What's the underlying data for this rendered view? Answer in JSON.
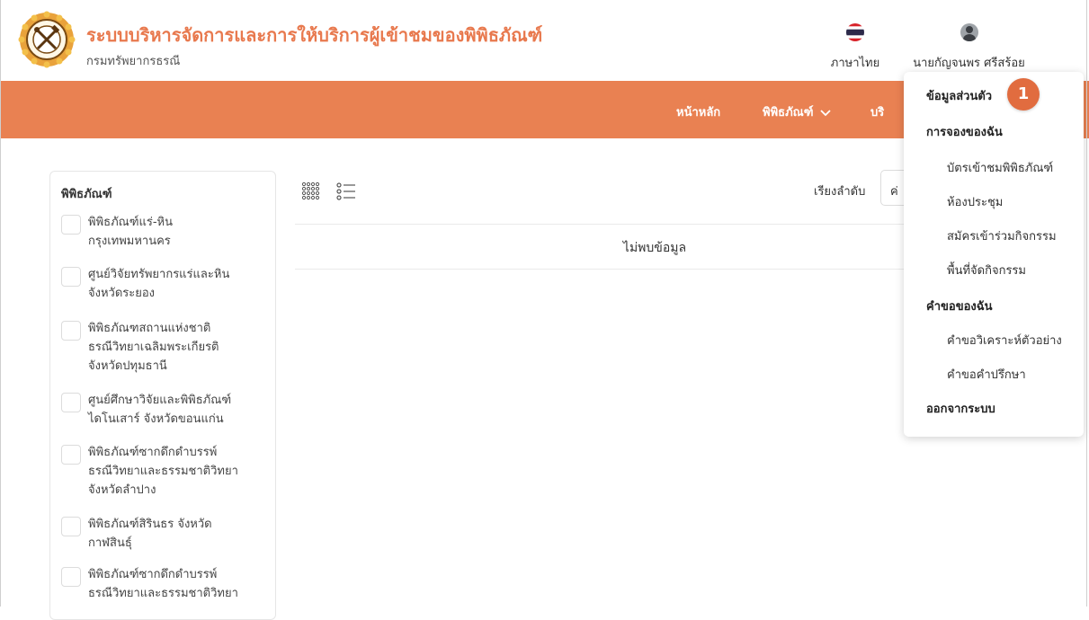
{
  "header": {
    "title": "ระบบบริหารจัดการและการให้บริการผู้เข้าชมของพิพิธภัณฑ์",
    "subtitle": "กรมทรัพยากรธรณี",
    "language_label": "ภาษาไทย",
    "user_name": "นายกัญจนพร ศรีสร้อย",
    "brand_color": "#e8794e"
  },
  "nav": {
    "home": "หน้าหลัก",
    "museum": "พิพิธภัณฑ์",
    "museum_chevron": "chevron-down-icon",
    "services_partial": "บริ",
    "bar_color": "#e98152"
  },
  "sidebar": {
    "title": "พิพิธภัณฑ์",
    "museums": [
      {
        "lines": [
          "พิพิธภัณฑ์แร่-หิน",
          "กรุงเทพมหานคร"
        ]
      },
      {
        "lines": [
          "ศูนย์วิจัยทรัพยากรแร่และหิน",
          "จังหวัดระยอง"
        ]
      },
      {
        "lines": [
          "พิพิธภัณฑสถานแห่งชาติ",
          "ธรณีวิทยาเฉลิมพระเกียรติ",
          "จังหวัดปทุมธานี"
        ]
      },
      {
        "lines": [
          "ศูนย์ศึกษาวิจัยและพิพิธภัณฑ์",
          "ไดโนเสาร์ จังหวัดขอนแก่น"
        ]
      },
      {
        "lines": [
          "พิพิธภัณฑ์ซากดึกดำบรรพ์",
          "ธรณีวิทยาและธรรมชาติวิทยา",
          "จังหวัดลำปาง"
        ]
      },
      {
        "lines": [
          "พิพิธภัณฑ์สิรินธร จังหวัด",
          "กาฬสินธุ์"
        ]
      },
      {
        "lines": [
          "พิพิธภัณฑ์ซากดึกดำบรรพ์",
          "ธรณีวิทยาและธรรมชาติวิทยา"
        ]
      }
    ]
  },
  "main": {
    "grid_view_icon": "grid-view-icon",
    "list_view_icon": "list-view-icon",
    "sort_label": "เรียงลำดับ",
    "sort_value_partial": "ค่",
    "empty_message": "ไม่พบข้อมูล"
  },
  "dropdown": {
    "profile": "ข้อมูลส่วนตัว",
    "my_bookings": "การจองของฉัน",
    "booking_items": [
      "บัตรเข้าชมพิพิธภัณฑ์",
      "ห้องประชุม",
      "สมัครเข้าร่วมกิจกรรม",
      "พื้นที่จัดกิจกรรม"
    ],
    "my_requests": "คำขอของฉัน",
    "request_items": [
      "คำขอวิเคราะห์ตัวอย่าง",
      "คำขอคำปรึกษา"
    ],
    "logout": "ออกจากระบบ",
    "step_badge": "1",
    "badge_color": "#e16c3f"
  }
}
